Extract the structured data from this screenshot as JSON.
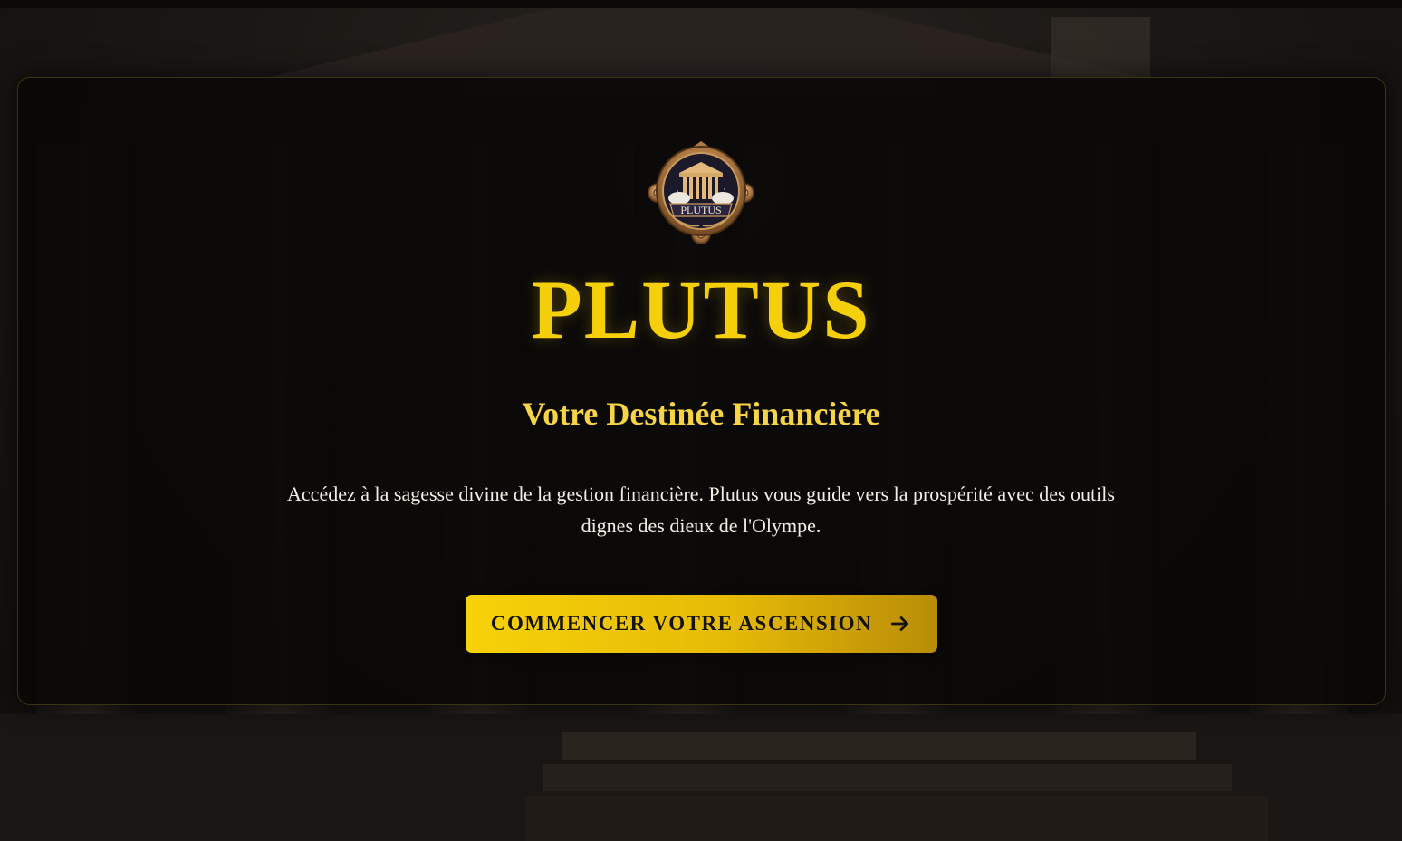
{
  "hero": {
    "logo_text": "PLUTUS",
    "title": "PLUTUS",
    "subtitle": "Votre Destinée Financière",
    "description": "Accédez à la sagesse divine de la gestion financière. Plutus vous guide vers la prospérité avec des outils dignes des dieux de l'Olympe.",
    "cta_label": "COMMENCER VOTRE ASCENSION",
    "cta_icon": "arrow-right-icon"
  },
  "colors": {
    "gold": "#f5cf0a",
    "subtitle_gold": "#f6d445",
    "background": "#0c0b0a",
    "text": "#f3efe6"
  }
}
